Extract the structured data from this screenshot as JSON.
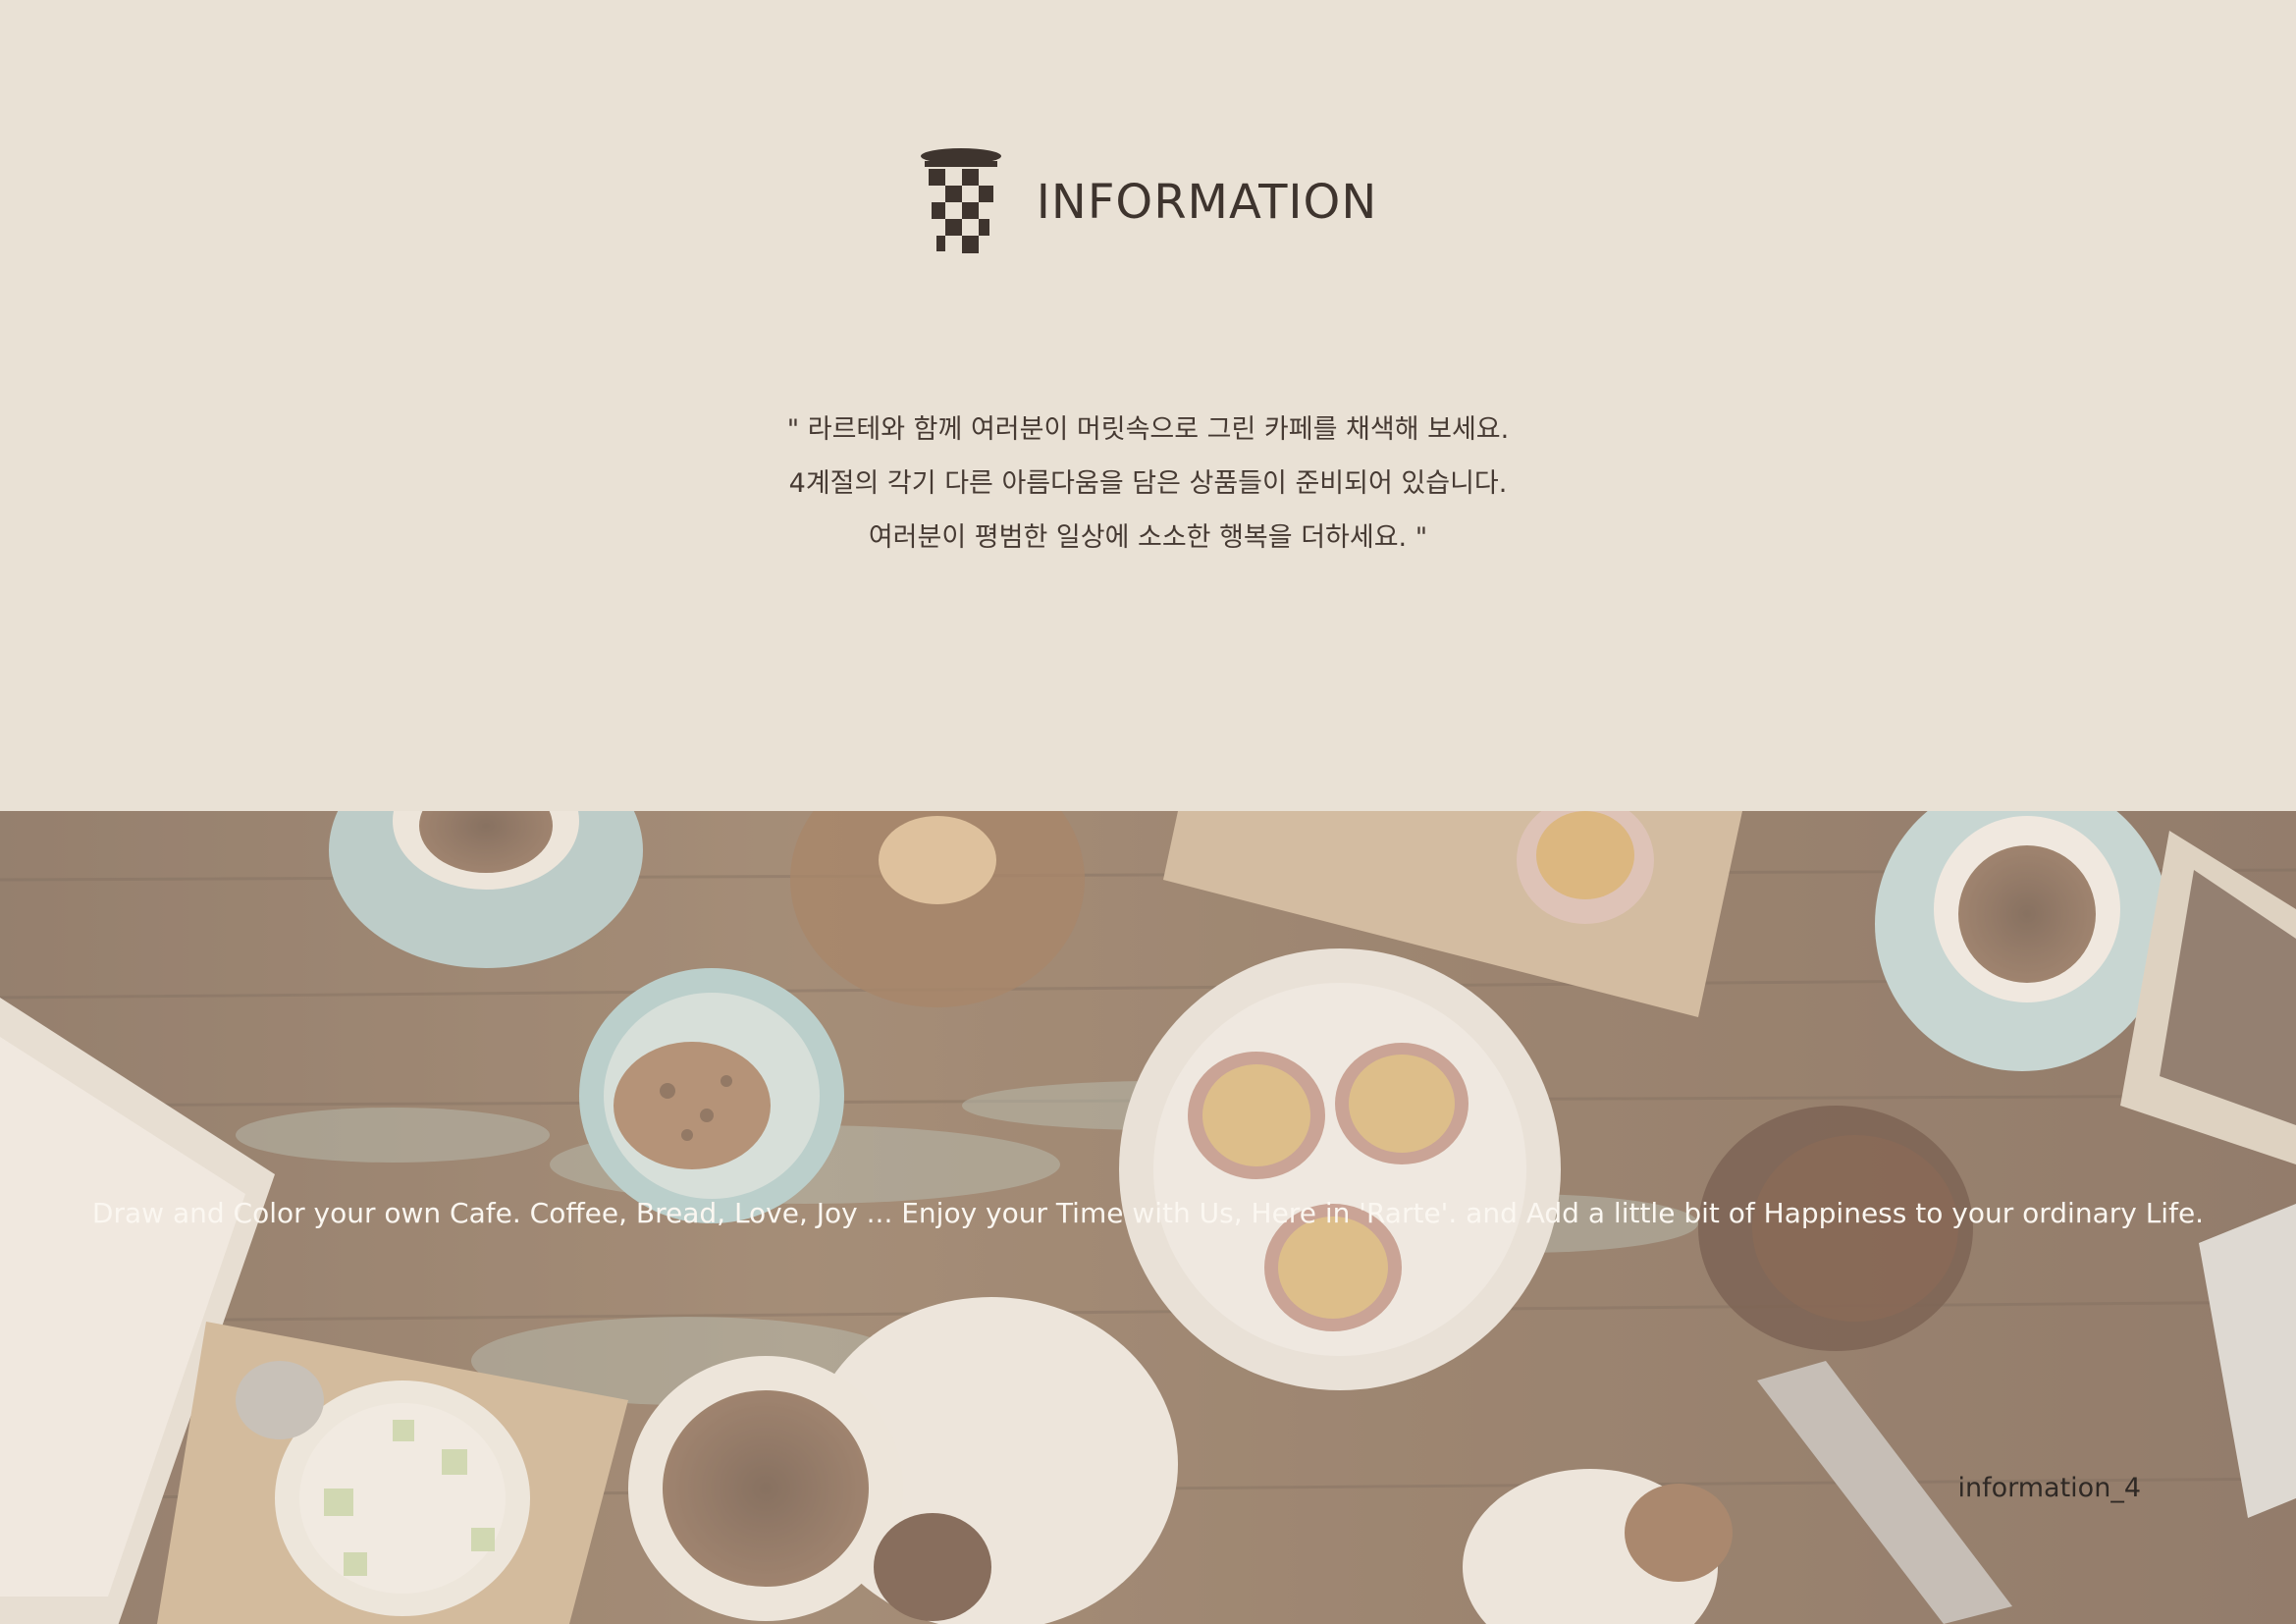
{
  "header": {
    "logo_icon": "checkered-cup-icon",
    "title": "INFORMATION"
  },
  "intro": {
    "lines": [
      "\" 라르테와 함께 여러분이 머릿속으로 그린 카페를 채색해 보세요.",
      "4계절의 각기 다른 아름다움을 담은 상품들이 준비되어 있습니다.",
      "여러분이 평범한 일상에 소소한 행복을 더하세요. \""
    ]
  },
  "photo": {
    "tagline": "Draw and Color your own Cafe. Coffee, Bread, Love, Joy ... Enjoy your Time with Us, Here in 'Rarte'. and Add a little bit of Happiness to your ordinary Life.",
    "page_label": "information_4"
  },
  "colors": {
    "background": "#e9e1d5",
    "heading": "#3e342e",
    "body_text": "#463a33",
    "wood": "#7a5c45",
    "overlay_tint": "#e8dccd"
  }
}
